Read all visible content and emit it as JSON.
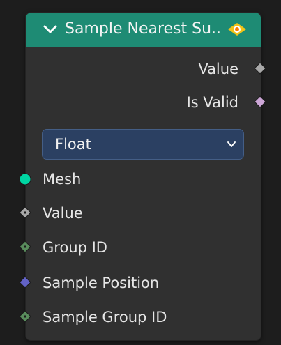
{
  "node": {
    "title": "Sample Nearest Su..",
    "header_icon": "chevron-down-icon",
    "warning_icon": "warning-eye-icon",
    "outputs": [
      {
        "label": "Value",
        "socket_color": "#a8a8a8"
      },
      {
        "label": "Is Valid",
        "socket_color": "#cca6d6"
      }
    ],
    "data_type": {
      "selected": "Float"
    },
    "inputs": [
      {
        "label": "Mesh",
        "socket_color": "#00d6a3"
      },
      {
        "label": "Value",
        "socket_color": "#a8a8a8"
      },
      {
        "label": "Group ID",
        "socket_color": "#598c5c"
      },
      {
        "label": "Sample Position",
        "socket_color": "#6363c7"
      },
      {
        "label": "Sample Group ID",
        "socket_color": "#598c5c"
      }
    ]
  },
  "colors": {
    "header": "#1e8b74",
    "node_body": "#303030",
    "dropdown_bg": "#2b4062",
    "background": "#1d1d1d"
  }
}
